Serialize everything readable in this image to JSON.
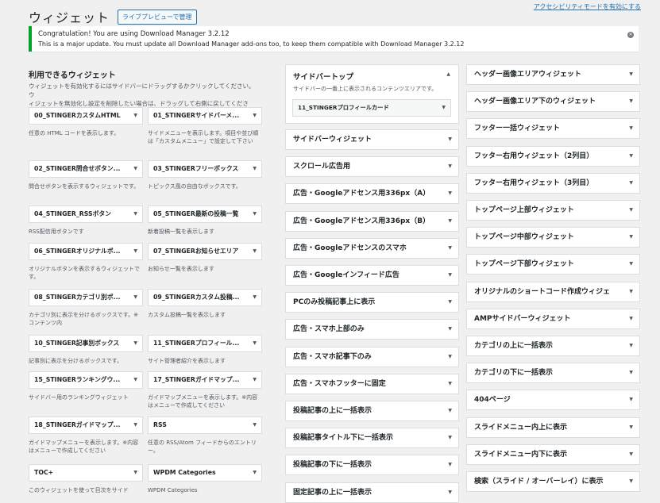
{
  "top_link": "アクセシビリティモードを有効にする",
  "header": {
    "title": "ウィジェット",
    "preview_button": "ライブプレビューで管理"
  },
  "notice": {
    "line1": "Congratulation! You are using Download Manager 3.2.12",
    "line2": "This is a major update. You must update all Download Manager add-ons too, to keep them compatible with Download Manager 3.2.12"
  },
  "available": {
    "title": "利用できるウィジェット",
    "desc1": "ウィジェットを有効化するにはサイドバーにドラッグするかクリックしてください。ウ",
    "desc2": "ィジェットを無効化し設定を削除したい場合は、ドラッグして右側に戻してください。",
    "widgets": [
      {
        "name": "00_STINGERカスタムHTML",
        "desc": "任意の HTML コードを表示します。"
      },
      {
        "name": "01_STINGERサイドバーメ...",
        "desc": "サイドメニューを表示します。項目や並び順は「カスタムメニュー」で設定して下さい"
      },
      {
        "name": "02_STINGER問合せボタン...",
        "desc": "問合せボタンを表示するウィジェットです。"
      },
      {
        "name": "03_STINGERフリーボックス",
        "desc": "トピックス風の自由なボックスです。"
      },
      {
        "name": "04_STINGER_RSSボタン",
        "desc": "RSS配信用ボタンです"
      },
      {
        "name": "05_STINGER最新の投稿一覧",
        "desc": "新着投稿一覧を表示します"
      },
      {
        "name": "06_STINGERオリジナルボ...",
        "desc": "オリジナルボタンを表示するウィジェットです。"
      },
      {
        "name": "07_STINGERお知らせエリア",
        "desc": "お知らせ一覧を表示します"
      },
      {
        "name": "08_STINGERカテゴリ別ボ...",
        "desc": "カテゴリ別に表示を分けるボックスです。※コンテンツ内"
      },
      {
        "name": "09_STINGERカスタム投稿...",
        "desc": "カスタム投稿一覧を表示します"
      },
      {
        "name": "10_STINGER記事別ボックス",
        "desc": "記事別に表示を分けるボックスです。"
      },
      {
        "name": "11_STINGERプロフィール...",
        "desc": "サイト管理者紹介を表示します"
      },
      {
        "name": "15_STINGERランキングウ...",
        "desc": "サイドバー用のランキングウィジェット"
      },
      {
        "name": "17_STINGERガイドマップ...",
        "desc": "ガイドマップメニューを表示します。※内容はメニューで作成してください"
      },
      {
        "name": "18_STINGERガイドマップ...",
        "desc": "ガイドマップメニューを表示します。※内容はメニューで作成してください"
      },
      {
        "name": "RSS",
        "desc": "任意の RSS/Atom フィードからのエントリー。"
      },
      {
        "name": "TOC+",
        "desc": "このウィジェットを使って目次をサイド"
      },
      {
        "name": "WPDM Categories",
        "desc": "WPDM Categories"
      }
    ]
  },
  "sidebar_top": {
    "title": "サイドバートップ",
    "desc": "サイドバーの一番上に表示されるコンテンツエリアです。",
    "widget": "11_STINGERプロフィールカード"
  },
  "middle_areas": [
    "サイドバーウィジェット",
    "スクロール広告用",
    "広告・Googleアドセンス用336px（A）",
    "広告・Googleアドセンス用336px（B）",
    "広告・Googleアドセンスのスマホ",
    "広告・Googleインフィード広告",
    "PCのみ投稿記事上に表示",
    "広告・スマホ上部のみ",
    "広告・スマホ記事下のみ",
    "広告・スマホフッターに固定",
    "投稿記事の上に一括表示",
    "投稿記事タイトル下に一括表示",
    "投稿記事の下に一括表示",
    "固定記事の上に一括表示"
  ],
  "right_areas": [
    "ヘッダー画像エリアウィジェット",
    "ヘッダー画像エリア下のウィジェット",
    "フッター一括ウィジェット",
    "フッター右用ウィジェット（2列目）",
    "フッター右用ウィジェット（3列目）",
    "トップページ上部ウィジェット",
    "トップページ中部ウィジェット",
    "トップページ下部ウィジェット",
    "オリジナルのショートコード作成ウィジェ",
    "AMPサイドバーウィジェット",
    "カテゴリの上に一括表示",
    "カテゴリの下に一括表示",
    "404ページ",
    "スライドメニュー内上に表示",
    "スライドメニュー内下に表示",
    "検索（スライド / オーバーレイ）に表示"
  ],
  "icons": {
    "dropdown": "chevron-down-icon",
    "collapse": "chevron-up-icon",
    "close": "close-icon"
  }
}
